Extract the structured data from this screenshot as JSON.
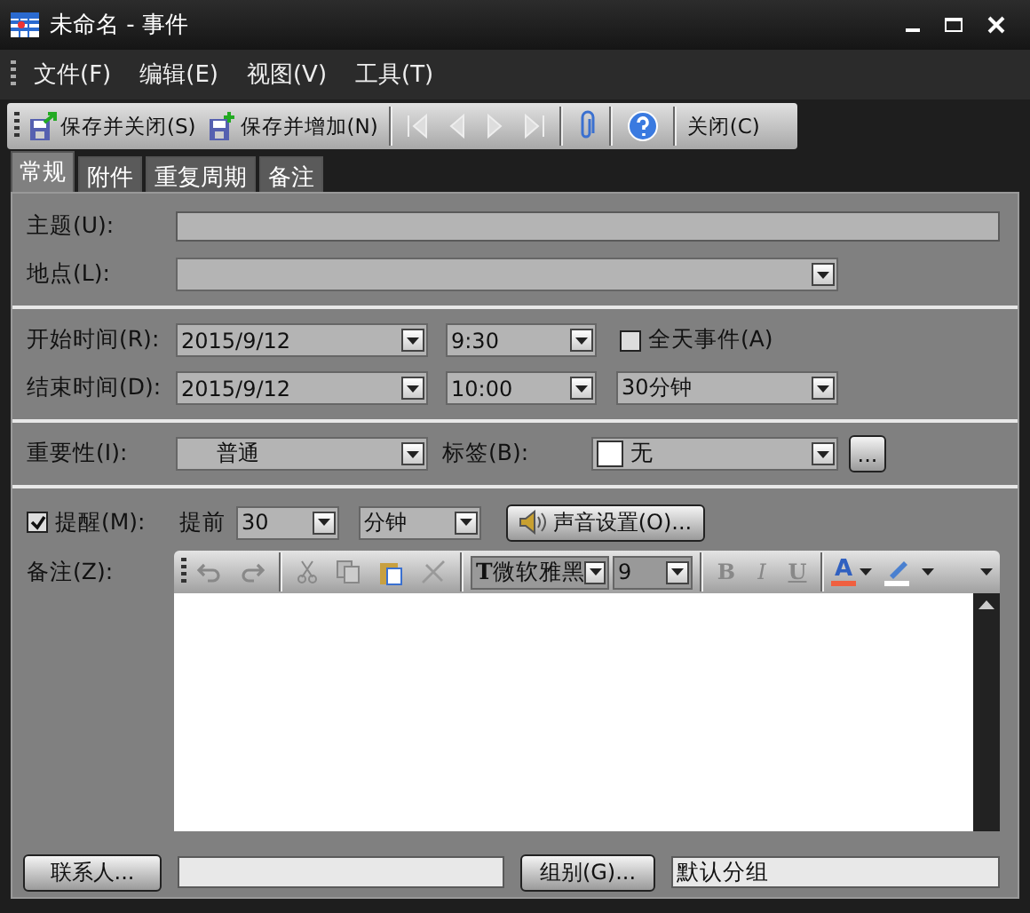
{
  "window": {
    "title": "未命名 - 事件"
  },
  "menu": [
    {
      "label": "文件(F)"
    },
    {
      "label": "编辑(E)"
    },
    {
      "label": "视图(V)"
    },
    {
      "label": "工具(T)"
    }
  ],
  "toolbar": {
    "save_close": "保存并关闭(S)",
    "save_new": "保存并增加(N)",
    "close": "关闭(C)"
  },
  "tabs": [
    {
      "label": "常规",
      "selected": true
    },
    {
      "label": "附件",
      "selected": false
    },
    {
      "label": "重复周期",
      "selected": false
    },
    {
      "label": "备注",
      "selected": false
    }
  ],
  "subject": {
    "label": "主题(U):"
  },
  "location": {
    "label": "地点(L):"
  },
  "start": {
    "label": "开始时间(R):",
    "date": "2015/9/12",
    "time": "9:30"
  },
  "all_day": {
    "label": "全天事件(A)",
    "checked": false
  },
  "end": {
    "label": "结束时间(D):",
    "date": "2015/9/12",
    "time": "10:00",
    "duration": "30分钟"
  },
  "importance": {
    "label": "重要性(I):",
    "value": "普通"
  },
  "tag": {
    "label": "标签(B):",
    "value": "无",
    "color": "#ffffff",
    "more": "..."
  },
  "reminder": {
    "label": "提醒(M):",
    "checked": true,
    "before_label": "提前",
    "amount": "30",
    "unit": "分钟",
    "sound_button": "声音设置(O)..."
  },
  "notes": {
    "label": "备注(Z):",
    "font_glyph": "T",
    "font": "微软雅黑",
    "size": "9",
    "format_buttons": [
      "B",
      "I",
      "U"
    ],
    "font_color_glyph": "A"
  },
  "contacts": {
    "button": "联系人..."
  },
  "group": {
    "button": "组别(G)...",
    "value": "默认分组"
  }
}
